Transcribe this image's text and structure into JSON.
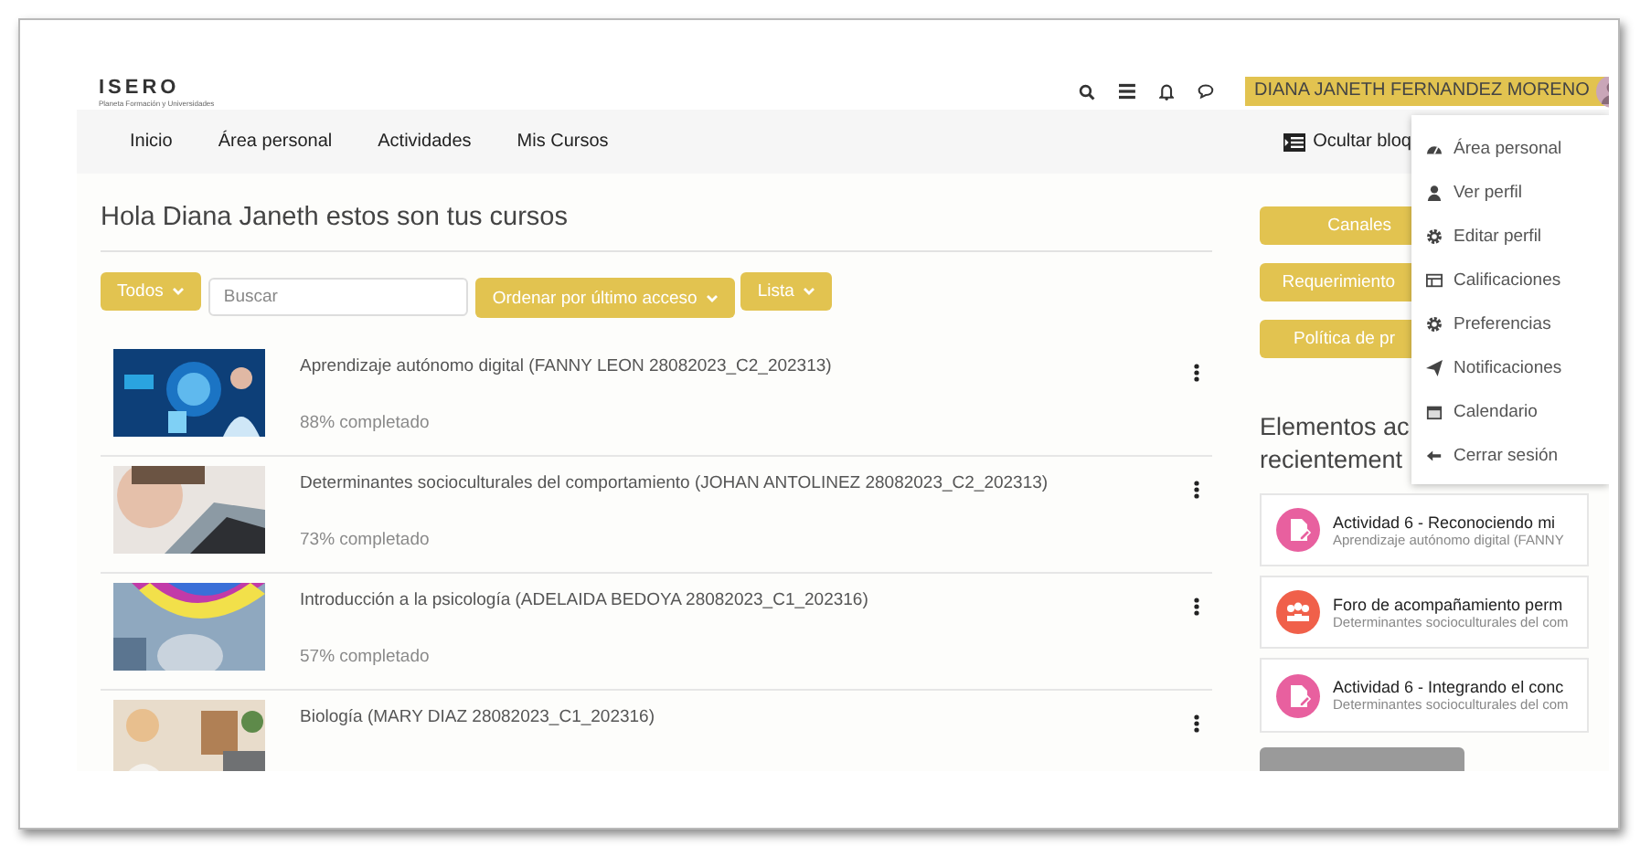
{
  "header": {
    "logo": "ISERO",
    "logo_subtitle": "Planeta Formación y Universidades",
    "user_name": "DIANA JANETH FERNANDEZ MORENO"
  },
  "nav": [
    "Inicio",
    "Área personal",
    "Actividades",
    "Mis Cursos"
  ],
  "hide_blocks": "Ocultar bloq",
  "heading": "Hola Diana Janeth estos son tus cursos",
  "filters": {
    "group": "Todos",
    "search_placeholder": "Buscar",
    "sort": "Ordenar por último acceso",
    "view": "Lista"
  },
  "courses": [
    {
      "title": "Aprendizaje autónomo digital (FANNY LEON 28082023_C2_202313)",
      "progress": "88% completado"
    },
    {
      "title": "Determinantes socioculturales del comportamiento (JOHAN ANTOLINEZ 28082023_C2_202313)",
      "progress": "73% completado"
    },
    {
      "title": "Introducción a la psicología (ADELAIDA BEDOYA 28082023_C1_202316)",
      "progress": "57% completado"
    },
    {
      "title": "Biología (MARY DIAZ 28082023_C1_202316)"
    }
  ],
  "side_buttons": [
    "Canales",
    "Requerimiento",
    "Política de pr"
  ],
  "recent": {
    "heading_lines": [
      "Elementos ac",
      "recientement"
    ],
    "items": [
      {
        "kind": "assignment",
        "color": "#e8609f",
        "title": "Actividad 6 - Reconociendo mi",
        "course": "Aprendizaje autónomo digital (FANNY"
      },
      {
        "kind": "forum",
        "color": "#f0604a",
        "title": "Foro de acompañamiento perm",
        "course": "Determinantes socioculturales del com"
      },
      {
        "kind": "assignment",
        "color": "#e8609f",
        "title": "Actividad 6 - Integrando el conc",
        "course": "Determinantes socioculturales del com"
      }
    ]
  },
  "user_menu": [
    {
      "label": "Área personal"
    },
    {
      "label": "Ver perfil"
    },
    {
      "label": "Editar perfil"
    },
    {
      "label": "Calificaciones"
    },
    {
      "label": "Preferencias"
    },
    {
      "label": "Notificaciones"
    },
    {
      "label": "Calendario"
    },
    {
      "label": "Cerrar sesión"
    }
  ]
}
